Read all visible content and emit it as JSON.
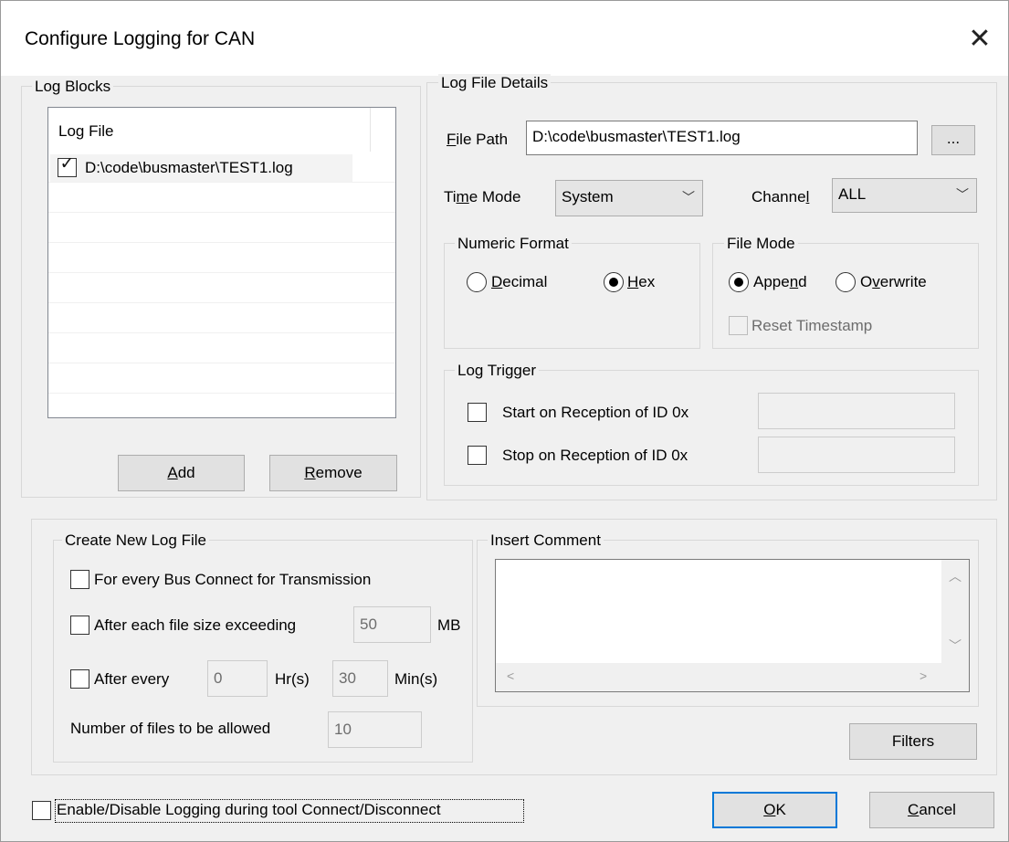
{
  "window": {
    "title": "Configure Logging for CAN",
    "close": "✕"
  },
  "log_blocks": {
    "group_label": "Log Blocks",
    "column_header": "Log File",
    "items": [
      {
        "checked": true,
        "label": "D:\\code\\busmaster\\TEST1.log"
      }
    ],
    "add_button": {
      "pre": "",
      "ul": "A",
      "post": "dd"
    },
    "remove_button": {
      "pre": "",
      "ul": "R",
      "post": "emove"
    }
  },
  "details": {
    "group_label": "Log File Details",
    "file_path_label": {
      "pre": "",
      "ul": "F",
      "post": "ile Path"
    },
    "file_path_value": "D:\\code\\busmaster\\TEST1.log",
    "browse_label": "...",
    "time_mode_label": {
      "pre": "Ti",
      "ul": "m",
      "post": "e Mode"
    },
    "time_mode_value": "System",
    "channel_label": {
      "pre": "Channe",
      "ul": "l",
      "post": ""
    },
    "channel_value": "ALL",
    "numeric_format": {
      "label": "Numeric Format",
      "decimal": {
        "pre": "",
        "ul": "D",
        "post": "ecimal",
        "selected": false
      },
      "hex": {
        "pre": "",
        "ul": "H",
        "post": "ex",
        "selected": true
      }
    },
    "file_mode": {
      "label": "File Mode",
      "append": {
        "pre": "Appe",
        "ul": "n",
        "post": "d",
        "selected": true
      },
      "overwrite": {
        "pre": "O",
        "ul": "v",
        "post": "erwrite",
        "selected": false
      },
      "reset_timestamp": "Reset Timestamp"
    },
    "log_trigger": {
      "label": "Log Trigger",
      "start": "Start on Reception of ID 0x",
      "stop": "Stop on Reception of ID 0x",
      "start_value": "",
      "stop_value": ""
    }
  },
  "create_new": {
    "group_label": "Create New Log File",
    "every_bus": "For every Bus Connect for Transmission",
    "after_size": "After each file size exceeding",
    "size_value": "50",
    "size_unit": "MB",
    "after_every": "After every",
    "hours_value": "0",
    "hours_unit": "Hr(s)",
    "minutes_value": "30",
    "minutes_unit": "Min(s)",
    "num_files_label": "Number of files to be allowed",
    "num_files_value": "10"
  },
  "insert_comment": {
    "group_label": "Insert Comment",
    "value": ""
  },
  "filters_button": "Filters",
  "enable_logging": "Enable/Disable Logging during tool Connect/Disconnect",
  "ok_button": {
    "pre": "",
    "ul": "O",
    "post": "K"
  },
  "cancel_button": {
    "pre": "",
    "ul": "C",
    "post": "ancel"
  }
}
